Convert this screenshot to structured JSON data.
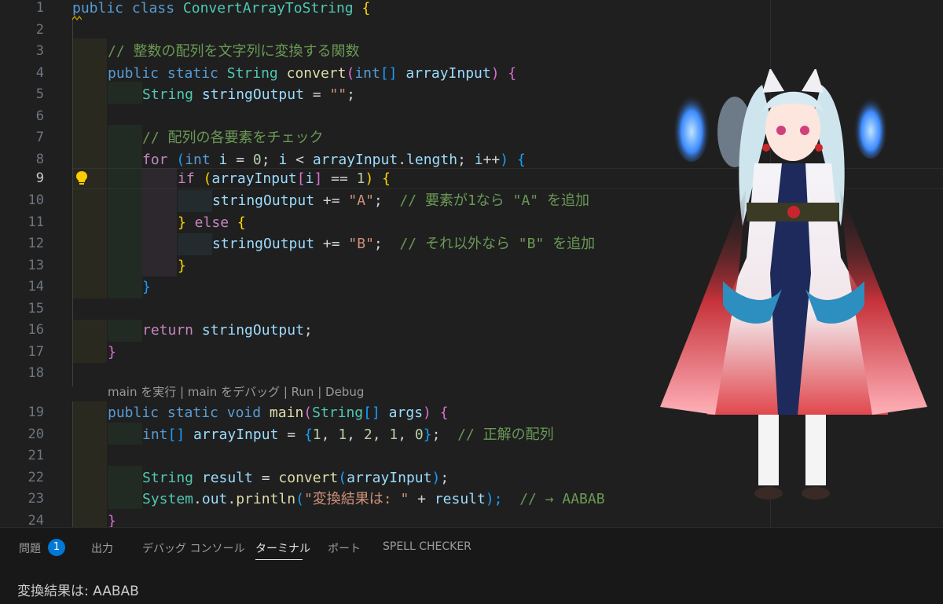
{
  "editor": {
    "line_numbers": [
      "1",
      "2",
      "3",
      "4",
      "5",
      "6",
      "7",
      "8",
      "9",
      "10",
      "11",
      "12",
      "13",
      "14",
      "15",
      "16",
      "17",
      "18",
      "19",
      "20",
      "21",
      "22",
      "23",
      "24"
    ],
    "active_line": "9",
    "codelens": "main を実行 | main をデバッグ | Run | Debug",
    "lines": {
      "l1": [
        "public",
        " class ",
        "ConvertArrayToString",
        " {"
      ],
      "l3": "// 整数の配列を文字列に変換する関数",
      "l4": [
        "public",
        " static ",
        "String",
        " convert",
        "(",
        "int",
        "[]",
        " arrayInput",
        ")",
        " {"
      ],
      "l5": [
        "String",
        " stringOutput",
        " = ",
        "\"\"",
        ";"
      ],
      "l7": "// 配列の各要素をチェック",
      "l8": [
        "for",
        " (",
        "int",
        " i",
        " = ",
        "0",
        "; ",
        "i",
        " < ",
        "arrayInput",
        ".",
        "length",
        "; ",
        "i",
        "++",
        ")",
        " {"
      ],
      "l9": [
        "if",
        " (",
        "arrayInput",
        "[",
        "i",
        "]",
        " == ",
        "1",
        ")",
        " {"
      ],
      "l10": [
        "stringOutput",
        " += ",
        "\"A\"",
        ";  ",
        "// 要素が1なら \"A\" を追加"
      ],
      "l11": [
        "}",
        " else ",
        "{"
      ],
      "l12": [
        "stringOutput",
        " += ",
        "\"B\"",
        ";  ",
        "// それ以外なら \"B\" を追加"
      ],
      "l13": "}",
      "l14": "}",
      "l16": [
        "return",
        " stringOutput",
        ";"
      ],
      "l17": "}",
      "l19": [
        "public",
        " static ",
        "void",
        " main",
        "(",
        "String",
        "[]",
        " args",
        ")",
        " {"
      ],
      "l20": [
        "int",
        "[]",
        " arrayInput",
        " = ",
        "{",
        "1",
        ", ",
        "1",
        ", ",
        "2",
        ", ",
        "1",
        ", ",
        "0",
        "}",
        ";  ",
        "// 正解の配列"
      ],
      "l22": [
        "String",
        " result",
        " = ",
        "convert",
        "(",
        "arrayInput",
        ")",
        ";"
      ],
      "l23": [
        "System",
        ".",
        "out",
        ".",
        "println",
        "(",
        "\"変換結果は: \"",
        " + ",
        "result",
        ");  ",
        "// → AABAB"
      ],
      "l24": "}"
    }
  },
  "panel": {
    "tabs": [
      "問題",
      "出力",
      "デバッグ コンソール",
      "ターミナル",
      "ポート",
      "SPELL CHECKER"
    ],
    "active_tab": "ターミナル",
    "problems_count": "1",
    "terminal_output": "変換結果は: AABAB"
  },
  "colors": {
    "background": "#1f1f1f",
    "keyword": "#569cd6",
    "type": "#4ec9b0",
    "function": "#dcdcaa",
    "variable": "#9cdcfe",
    "string": "#ce9178",
    "comment": "#6a9955",
    "badge": "#0078d4"
  },
  "icons": [
    "lightbulb-icon",
    "anime-character-illustration"
  ]
}
